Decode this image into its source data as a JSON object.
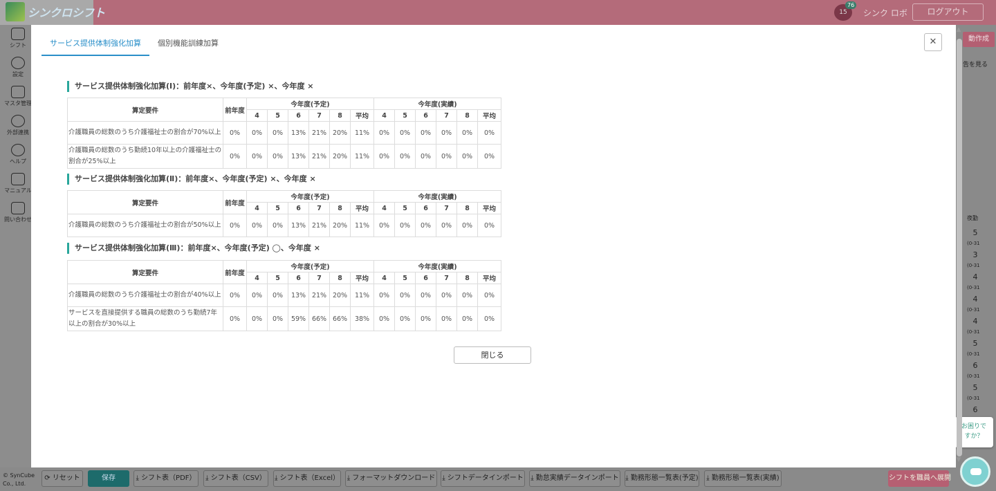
{
  "app": {
    "logo_text": "シンクロシフト",
    "calendar_day": "15",
    "notification_count": "76",
    "user_name": "シンク ロボ",
    "logout_label": "ログアウト"
  },
  "sidebar": {
    "items": [
      {
        "label": "シフト",
        "icon": "calendar-icon"
      },
      {
        "label": "設定",
        "icon": "gear-icon"
      },
      {
        "label": "マスタ管理",
        "icon": "database-icon"
      },
      {
        "label": "外部連携",
        "icon": "cloud-icon"
      },
      {
        "label": "ヘルプ",
        "icon": "help-icon"
      },
      {
        "label": "マニュアル",
        "icon": "manual-icon"
      },
      {
        "label": "問い合わせ",
        "icon": "mail-icon"
      }
    ]
  },
  "behind": {
    "auto_create_label": "動作成",
    "view_link": "告を見る",
    "col_header": "夜勤",
    "nums": [
      "5",
      "3",
      "4",
      "4",
      "4",
      "5",
      "6",
      "5",
      "6"
    ],
    "sub": "(0-31"
  },
  "footer": {
    "copyright_1": "© SynCube",
    "copyright_2": "Co., Ltd.",
    "buttons": [
      "リセット",
      "保存",
      "シフト表（PDF）",
      "シフト表（CSV）",
      "シフト表（Excel）",
      "フォーマットダウンロード",
      "シフトデータインポート",
      "勤怠実績データインポート",
      "勤務形態一覧表(予定)",
      "勤務形態一覧表(実績)",
      "シフトを職員へ展開"
    ]
  },
  "help": {
    "bubble_line1": "お困りで",
    "bubble_line2": "すか？"
  },
  "modal": {
    "tabs": [
      "サービス提供体制強化加算",
      "個別機能訓練加算"
    ],
    "active_tab": 0,
    "close_label": "閉じる",
    "headers": {
      "requirement": "算定要件",
      "prev_year": "前年度",
      "plan": "今年度(予定)",
      "actual": "今年度(実績)",
      "months": [
        "4",
        "5",
        "6",
        "7",
        "8",
        "平均"
      ]
    },
    "sections": [
      {
        "title": "サービス提供体制強化加算(Ⅰ)：前年度×、今年度(予定) ×、今年度 ×",
        "rows": [
          {
            "label": "介護職員の総数のうち介護福祉士の割合が70%以上",
            "prev": "0%",
            "plan": [
              "0%",
              "0%",
              "13%",
              "21%",
              "20%",
              "11%"
            ],
            "actual": [
              "0%",
              "0%",
              "0%",
              "0%",
              "0%",
              "0%"
            ]
          },
          {
            "label": "介護職員の総数のうち勤続10年以上の介護福祉士の割合が25%以上",
            "prev": "0%",
            "plan": [
              "0%",
              "0%",
              "13%",
              "21%",
              "20%",
              "11%"
            ],
            "actual": [
              "0%",
              "0%",
              "0%",
              "0%",
              "0%",
              "0%"
            ]
          }
        ]
      },
      {
        "title": "サービス提供体制強化加算(Ⅱ)：前年度×、今年度(予定) ×、今年度 ×",
        "rows": [
          {
            "label": "介護職員の総数のうち介護福祉士の割合が50%以上",
            "prev": "0%",
            "plan": [
              "0%",
              "0%",
              "13%",
              "21%",
              "20%",
              "11%"
            ],
            "actual": [
              "0%",
              "0%",
              "0%",
              "0%",
              "0%",
              "0%"
            ]
          }
        ]
      },
      {
        "title": "サービス提供体制強化加算(Ⅲ)：前年度×、今年度(予定) ◯、今年度 ×",
        "rows": [
          {
            "label": "介護職員の総数のうち介護福祉士の割合が40%以上",
            "prev": "0%",
            "plan": [
              "0%",
              "0%",
              "13%",
              "21%",
              "20%",
              "11%"
            ],
            "actual": [
              "0%",
              "0%",
              "0%",
              "0%",
              "0%",
              "0%"
            ]
          },
          {
            "label": "サービスを直接提供する職員の総数のうち勤続7年以上の割合が30%以上",
            "prev": "0%",
            "plan": [
              "0%",
              "0%",
              "59%",
              "66%",
              "66%",
              "38%"
            ],
            "actual": [
              "0%",
              "0%",
              "0%",
              "0%",
              "0%",
              "0%"
            ]
          }
        ]
      }
    ]
  }
}
